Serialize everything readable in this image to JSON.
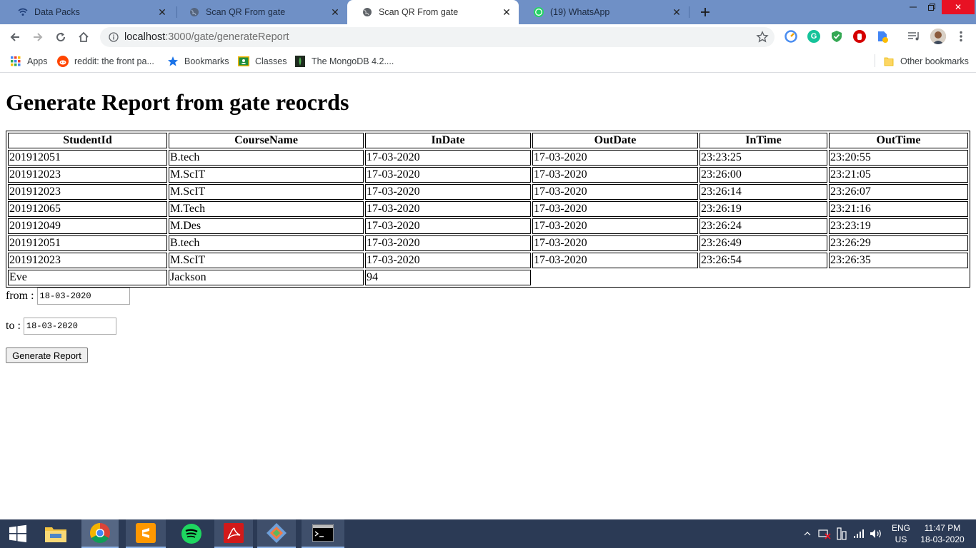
{
  "browser": {
    "tabs": [
      {
        "label": "Data Packs",
        "icon": "wifi-icon"
      },
      {
        "label": "Scan QR From gate",
        "icon": "globe-icon"
      },
      {
        "label": "Scan QR From gate",
        "icon": "globe-icon",
        "active": true
      },
      {
        "label": "(19) WhatsApp",
        "icon": "whatsapp-icon"
      }
    ],
    "url_host": "localhost",
    "url_path": ":3000/gate/generateReport",
    "bookmarks": [
      {
        "label": "Apps",
        "icon": "apps-grid-icon"
      },
      {
        "label": "reddit: the front pa...",
        "icon": "reddit-icon"
      },
      {
        "label": "Bookmarks",
        "icon": "star-icon"
      },
      {
        "label": "Classes",
        "icon": "classroom-icon"
      },
      {
        "label": "The MongoDB 4.2....",
        "icon": "mongodb-leaf-icon"
      }
    ],
    "other_bookmarks": "Other bookmarks"
  },
  "page": {
    "title": "Generate Report from gate reocrds",
    "table": {
      "headers": [
        "StudentId",
        "CourseName",
        "InDate",
        "OutDate",
        "InTime",
        "OutTime"
      ],
      "rows": [
        [
          "201912051",
          "B.tech",
          "17-03-2020",
          "17-03-2020",
          "23:23:25",
          "23:20:55"
        ],
        [
          "201912023",
          "M.ScIT",
          "17-03-2020",
          "17-03-2020",
          "23:26:00",
          "23:21:05"
        ],
        [
          "201912023",
          "M.ScIT",
          "17-03-2020",
          "17-03-2020",
          "23:26:14",
          "23:26:07"
        ],
        [
          "201912065",
          "M.Tech",
          "17-03-2020",
          "17-03-2020",
          "23:26:19",
          "23:21:16"
        ],
        [
          "201912049",
          "M.Des",
          "17-03-2020",
          "17-03-2020",
          "23:26:24",
          "23:23:19"
        ],
        [
          "201912051",
          "B.tech",
          "17-03-2020",
          "17-03-2020",
          "23:26:49",
          "23:26:29"
        ],
        [
          "201912023",
          "M.ScIT",
          "17-03-2020",
          "17-03-2020",
          "23:26:54",
          "23:26:35"
        ]
      ],
      "extra_row": [
        "Eve",
        "Jackson",
        "94"
      ]
    },
    "from_label": "from :",
    "from_value": "18-03-2020",
    "to_label": "to :",
    "to_value": "18-03-2020",
    "button_label": "Generate Report"
  },
  "taskbar": {
    "lang_top": "ENG",
    "lang_bottom": "US",
    "time": "11:47 PM",
    "date": "18-03-2020"
  }
}
